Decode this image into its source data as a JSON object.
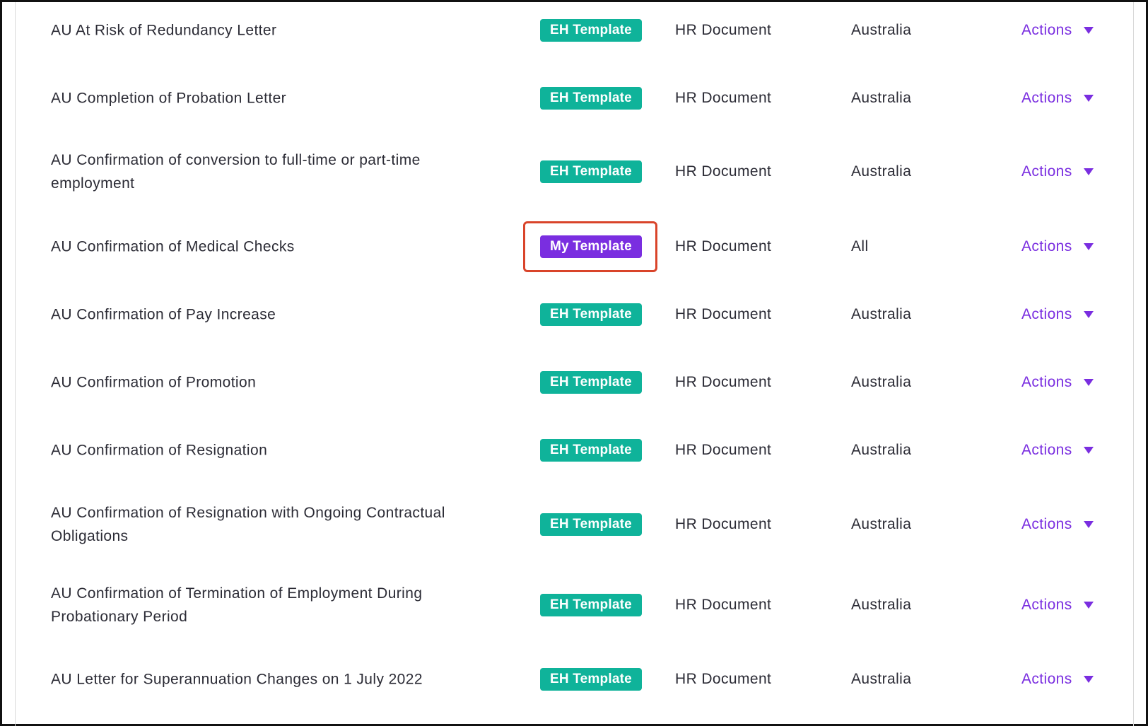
{
  "colors": {
    "eh_badge": "#0fb39a",
    "my_badge": "#7a2ee0",
    "actions_link": "#7a2ee0",
    "highlight_box": "#d9442a"
  },
  "rows": [
    {
      "name": "AU At Risk of Redundancy Letter",
      "badge": "EH Template",
      "type": "HR Document",
      "country": "Australia",
      "actions": "Actions"
    },
    {
      "name": "AU Completion of Probation Letter",
      "badge": "EH Template",
      "type": "HR Document",
      "country": "Australia",
      "actions": "Actions"
    },
    {
      "name": "AU Confirmation of conversion to full-time or part-time employment",
      "badge": "EH Template",
      "type": "HR Document",
      "country": "Australia",
      "actions": "Actions"
    },
    {
      "name": "AU Confirmation of Medical Checks",
      "badge": "My Template",
      "type": "HR Document",
      "country": "All",
      "actions": "Actions"
    },
    {
      "name": "AU Confirmation of Pay Increase",
      "badge": "EH Template",
      "type": "HR Document",
      "country": "Australia",
      "actions": "Actions"
    },
    {
      "name": "AU Confirmation of Promotion",
      "badge": "EH Template",
      "type": "HR Document",
      "country": "Australia",
      "actions": "Actions"
    },
    {
      "name": "AU Confirmation of Resignation",
      "badge": "EH Template",
      "type": "HR Document",
      "country": "Australia",
      "actions": "Actions"
    },
    {
      "name": "AU Confirmation of Resignation with Ongoing Contractual Obligations",
      "badge": "EH Template",
      "type": "HR Document",
      "country": "Australia",
      "actions": "Actions"
    },
    {
      "name": "AU Confirmation of Termination of Employment During Probationary Period",
      "badge": "EH Template",
      "type": "HR Document",
      "country": "Australia",
      "actions": "Actions"
    },
    {
      "name": "AU Letter for Superannuation Changes on 1 July 2022",
      "badge": "EH Template",
      "type": "HR Document",
      "country": "Australia",
      "actions": "Actions"
    }
  ]
}
